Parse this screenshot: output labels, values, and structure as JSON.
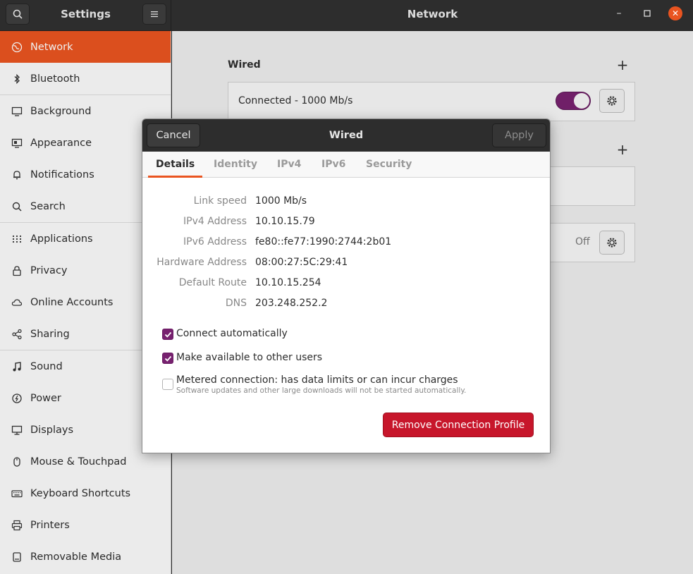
{
  "app": {
    "settings_title": "Settings",
    "panel_title": "Network"
  },
  "sidebar": {
    "items": [
      {
        "label": "Network",
        "icon": "globe-icon"
      },
      {
        "label": "Bluetooth",
        "icon": "bluetooth-icon"
      },
      {
        "label": "Background",
        "icon": "monitor-icon"
      },
      {
        "label": "Appearance",
        "icon": "appearance-icon"
      },
      {
        "label": "Notifications",
        "icon": "bell-icon"
      },
      {
        "label": "Search",
        "icon": "search-icon"
      },
      {
        "label": "Applications",
        "icon": "grid-icon"
      },
      {
        "label": "Privacy",
        "icon": "lock-icon"
      },
      {
        "label": "Online Accounts",
        "icon": "cloud-icon"
      },
      {
        "label": "Sharing",
        "icon": "share-icon"
      },
      {
        "label": "Sound",
        "icon": "music-note-icon"
      },
      {
        "label": "Power",
        "icon": "power-icon"
      },
      {
        "label": "Displays",
        "icon": "display-icon"
      },
      {
        "label": "Mouse & Touchpad",
        "icon": "mouse-icon"
      },
      {
        "label": "Keyboard Shortcuts",
        "icon": "keyboard-icon"
      },
      {
        "label": "Printers",
        "icon": "printer-icon"
      },
      {
        "label": "Removable Media",
        "icon": "drive-icon"
      }
    ]
  },
  "network": {
    "wired_title": "Wired",
    "wired_status": "Connected - 1000 Mb/s",
    "proxy_status": "Off"
  },
  "dialog": {
    "title": "Wired",
    "cancel_label": "Cancel",
    "apply_label": "Apply",
    "tabs": [
      "Details",
      "Identity",
      "IPv4",
      "IPv6",
      "Security"
    ],
    "details": [
      {
        "key": "Link speed",
        "value": "1000 Mb/s"
      },
      {
        "key": "IPv4 Address",
        "value": "10.10.15.79"
      },
      {
        "key": "IPv6 Address",
        "value": "fe80::fe77:1990:2744:2b01"
      },
      {
        "key": "Hardware Address",
        "value": "08:00:27:5C:29:41"
      },
      {
        "key": "Default Route",
        "value": "10.10.15.254"
      },
      {
        "key": "DNS",
        "value": "203.248.252.2"
      }
    ],
    "connect_auto_label": "Connect automatically",
    "connect_auto_checked": true,
    "available_users_label": "Make available to other users",
    "available_users_checked": true,
    "metered_label": "Metered connection: has data limits or can incur charges",
    "metered_sub": "Software updates and other large downloads will not be started automatically.",
    "metered_checked": false,
    "remove_label": "Remove Connection Profile"
  },
  "colors": {
    "accent": "#e95420",
    "toggle": "#77216f",
    "danger": "#c7162b"
  }
}
